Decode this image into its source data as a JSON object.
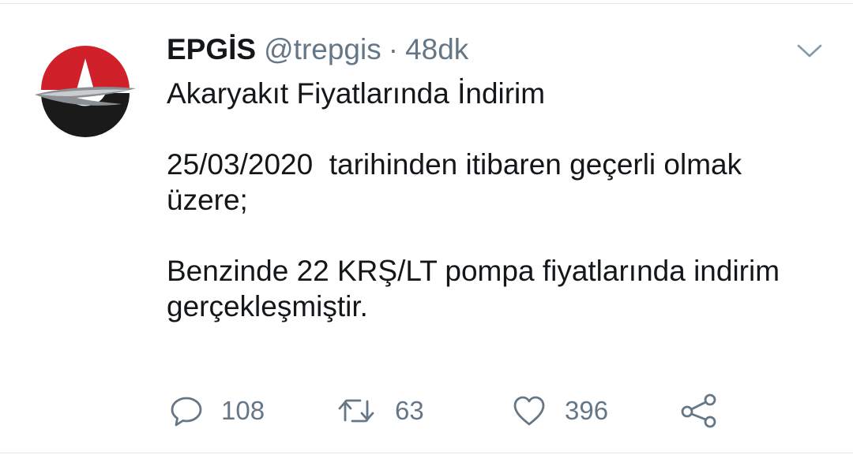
{
  "tweet": {
    "author_name": "EPGİS",
    "handle": "@trepgis",
    "separator": "·",
    "time": "48dk",
    "paragraphs": [
      "Akaryakıt Fiyatlarında İndirim",
      "25/03/2020  tarihinden itibaren geçerli olmak üzere;",
      "Benzinde 22 KRŞ/LT pompa fiyatlarında indirim gerçekleşmiştir."
    ],
    "avatar": {
      "icon": "epgis-logo-icon",
      "colors": {
        "red": "#d0202a",
        "black": "#1a1a1a",
        "gray": "#8a8f94"
      }
    }
  },
  "actions": {
    "reply": {
      "icon": "reply-icon",
      "count": "108"
    },
    "retweet": {
      "icon": "retweet-icon",
      "count": "63"
    },
    "like": {
      "icon": "heart-icon",
      "count": "396"
    },
    "share": {
      "icon": "share-icon"
    }
  },
  "menu": {
    "icon": "chevron-down-icon"
  },
  "colors": {
    "text_primary": "#14171a",
    "text_secondary": "#657786",
    "divider": "#e1e8ed",
    "icon": "#657786"
  }
}
